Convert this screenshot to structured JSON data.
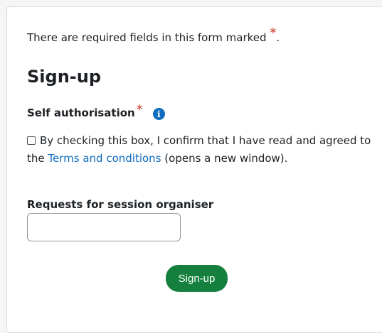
{
  "form": {
    "notice_text": "There are required fields in this form marked",
    "notice_star": "*",
    "notice_period": ".",
    "title": "Sign-up",
    "self_auth": {
      "label": "Self authorisation",
      "required_star": "*",
      "info_glyph": "i",
      "icon": "info-icon",
      "checked": false,
      "consent_text_before": "By checking this box, I confirm that I have read and agreed to the",
      "link_text": "Terms and conditions",
      "consent_text_after": "(opens a new window)."
    },
    "requests": {
      "label": "Requests for session organiser",
      "value": "",
      "placeholder": ""
    },
    "submit_label": "Sign-up"
  },
  "colors": {
    "required": "#ca3120",
    "link": "#0f6cbf",
    "info_icon": "#0f6cbf",
    "button": "#15803d"
  }
}
